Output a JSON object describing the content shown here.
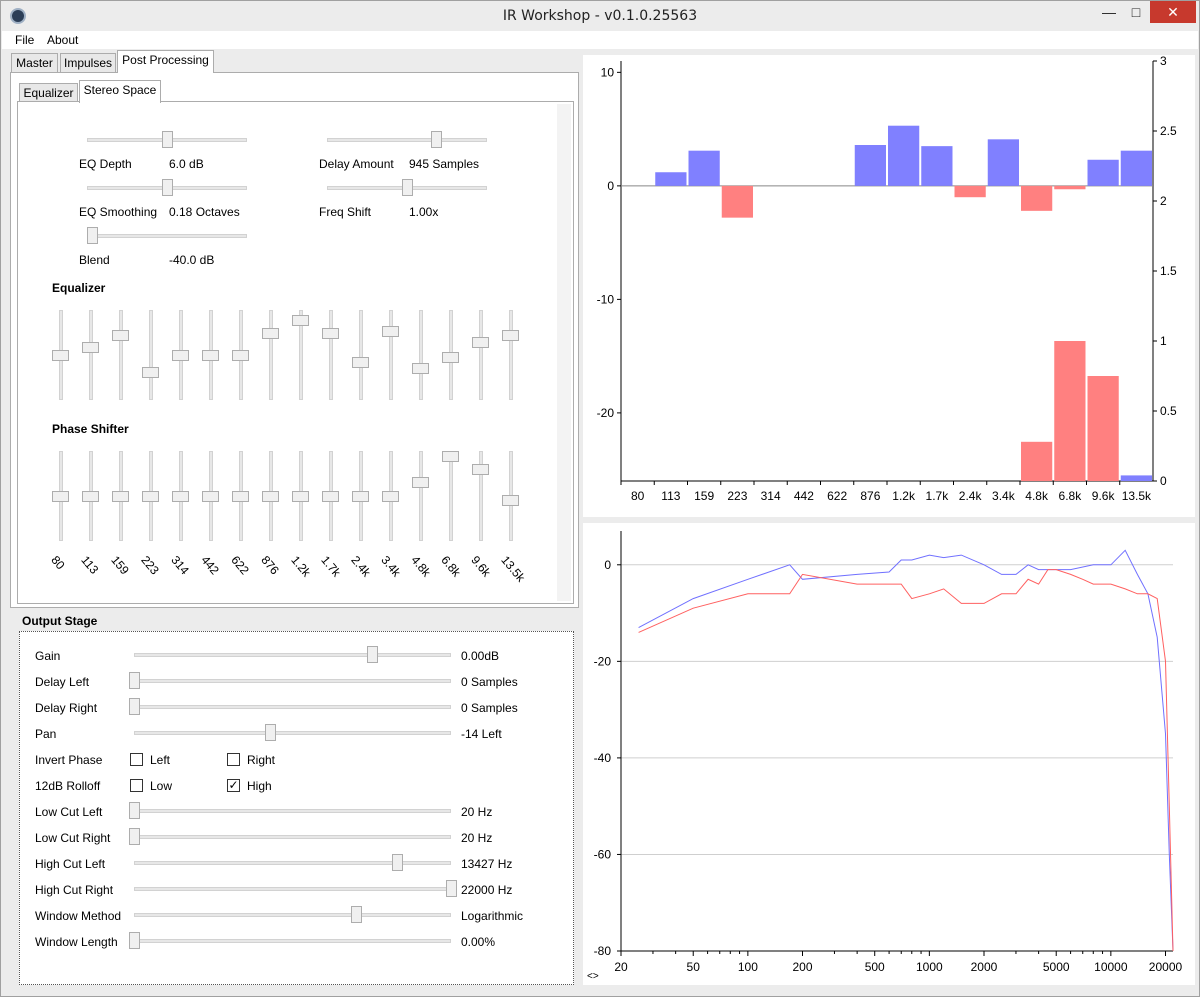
{
  "window": {
    "title": "IR Workshop - v0.1.0.25563",
    "minimize": "—",
    "maximize": "□",
    "close": "✕"
  },
  "menu": [
    {
      "label": "File"
    },
    {
      "label": "About"
    }
  ],
  "tabs": [
    {
      "label": "Master"
    },
    {
      "label": "Impulses"
    },
    {
      "label": "Post Processing"
    }
  ],
  "subtabs": [
    {
      "label": "Equalizer"
    },
    {
      "label": "Stereo Space"
    }
  ],
  "stereo": {
    "eq_depth": {
      "label": "EQ Depth",
      "value": "6.0 dB",
      "level": 0.5
    },
    "eq_smoothing": {
      "label": "EQ Smoothing",
      "value": "0.18 Octaves",
      "level": 0.5
    },
    "blend": {
      "label": "Blend",
      "value": "-40.0 dB",
      "level": 0.0
    },
    "delay_amount": {
      "label": "Delay Amount",
      "value": "945 Samples",
      "level": 0.7
    },
    "freq_shift": {
      "label": "Freq Shift",
      "value": "1.00x",
      "level": 0.5
    }
  },
  "equalizer_heading": "Equalizer",
  "phase_heading": "Phase Shifter",
  "bands": [
    "80",
    "113",
    "159",
    "223",
    "314",
    "442",
    "622",
    "876",
    "1.2k",
    "1.7k",
    "2.4k",
    "3.4k",
    "4.8k",
    "6.8k",
    "9.6k",
    "13.5k"
  ],
  "eq_levels": [
    0.5,
    0.6,
    0.75,
    0.28,
    0.5,
    0.5,
    0.5,
    0.77,
    0.94,
    0.77,
    0.4,
    0.8,
    0.33,
    0.47,
    0.66,
    0.75
  ],
  "phase_levels": [
    0.5,
    0.5,
    0.5,
    0.5,
    0.5,
    0.5,
    0.5,
    0.5,
    0.5,
    0.5,
    0.5,
    0.5,
    0.67,
    1.0,
    0.83,
    0.44
  ],
  "output": {
    "heading": "Output Stage",
    "rows": [
      {
        "label": "Gain",
        "value": "0.00dB",
        "level": 0.75
      },
      {
        "label": "Delay Left",
        "value": "0 Samples",
        "level": 0.0
      },
      {
        "label": "Delay Right",
        "value": "0 Samples",
        "level": 0.0
      },
      {
        "label": "Pan",
        "value": "-14 Left",
        "level": 0.43
      },
      {
        "label": "Low Cut Left",
        "value": "20 Hz",
        "level": 0.0
      },
      {
        "label": "Low Cut Right",
        "value": "20 Hz",
        "level": 0.0
      },
      {
        "label": "High Cut Left",
        "value": "13427 Hz",
        "level": 0.83
      },
      {
        "label": "High Cut Right",
        "value": "22000 Hz",
        "level": 1.0
      },
      {
        "label": "Window Method",
        "value": "Logarithmic",
        "level": 0.7
      },
      {
        "label": "Window Length",
        "value": "0.00%",
        "level": 0.0
      }
    ],
    "invert_phase": {
      "label": "Invert Phase",
      "left": "Left",
      "right": "Right",
      "left_checked": false,
      "right_checked": false
    },
    "rolloff": {
      "label": "12dB Rolloff",
      "low": "Low",
      "high": "High",
      "low_checked": false,
      "high_checked": true
    }
  },
  "colors": {
    "blue": "#8080ff",
    "red": "#ff8080",
    "blue_line": "#7070ff",
    "red_line": "#ff6060"
  },
  "chart_data": [
    {
      "type": "bar",
      "categories": [
        "80",
        "113",
        "159",
        "223",
        "314",
        "442",
        "622",
        "876",
        "1.2k",
        "1.7k",
        "2.4k",
        "3.4k",
        "4.8k",
        "6.8k",
        "9.6k",
        "13.5k"
      ],
      "series": [
        {
          "axis": "left",
          "values": [
            0,
            1.2,
            3.1,
            -2.8,
            0,
            0,
            0,
            3.6,
            5.3,
            3.5,
            -1.0,
            4.1,
            -2.2,
            -0.3,
            2.3,
            3.1
          ]
        },
        {
          "axis": "right",
          "values": [
            0,
            0,
            0,
            0,
            0,
            0,
            0,
            0,
            0,
            0,
            0,
            0,
            0.28,
            1.0,
            0.75,
            0.04
          ]
        }
      ],
      "ylim": [
        -26,
        11
      ],
      "y_ticks": [
        "10",
        "0",
        "-10",
        "-20"
      ],
      "y2lim": [
        0,
        3
      ],
      "y2_ticks": [
        "3",
        "2.5",
        "2",
        "1.5",
        "1",
        "0.5",
        "0"
      ]
    },
    {
      "type": "line",
      "xscale": "log",
      "xlim": [
        20,
        22000
      ],
      "ylim": [
        -80,
        7
      ],
      "x_ticks": [
        "20",
        "50",
        "100",
        "200",
        "500",
        "1000",
        "2000",
        "5000",
        "10000",
        "20000"
      ],
      "y_ticks": [
        "0",
        "-20",
        "-40",
        "-60",
        "-80"
      ],
      "series": [
        {
          "color": "blue",
          "x": [
            25,
            50,
            100,
            170,
            200,
            400,
            600,
            700,
            800,
            1000,
            1200,
            1500,
            2000,
            2500,
            3000,
            3500,
            4000,
            5000,
            6000,
            8000,
            10000,
            12000,
            14000,
            16000,
            18000,
            20000,
            21000,
            22000
          ],
          "y": [
            -13,
            -7,
            -3,
            0,
            -3,
            -2,
            -1.5,
            1,
            1,
            2,
            1.5,
            2,
            0,
            -2,
            -2,
            0,
            -1,
            -1,
            -1,
            0,
            0,
            3,
            -2,
            -6,
            -15,
            -35,
            -60,
            -80
          ]
        },
        {
          "color": "red",
          "x": [
            25,
            50,
            100,
            170,
            200,
            400,
            700,
            800,
            1000,
            1200,
            1500,
            2000,
            2500,
            3000,
            3500,
            4000,
            4500,
            5000,
            6000,
            7000,
            8000,
            10000,
            12000,
            14000,
            16000,
            18000,
            20000,
            21000,
            22000
          ],
          "y": [
            -14,
            -9,
            -6,
            -6,
            -2,
            -4,
            -4,
            -7,
            -6,
            -5,
            -8,
            -8,
            -6,
            -6,
            -3,
            -4,
            -1,
            -1,
            -2,
            -3,
            -4,
            -4,
            -5,
            -6,
            -6,
            -7,
            -20,
            -50,
            -80
          ]
        }
      ]
    }
  ],
  "scroll_hint": "<>"
}
